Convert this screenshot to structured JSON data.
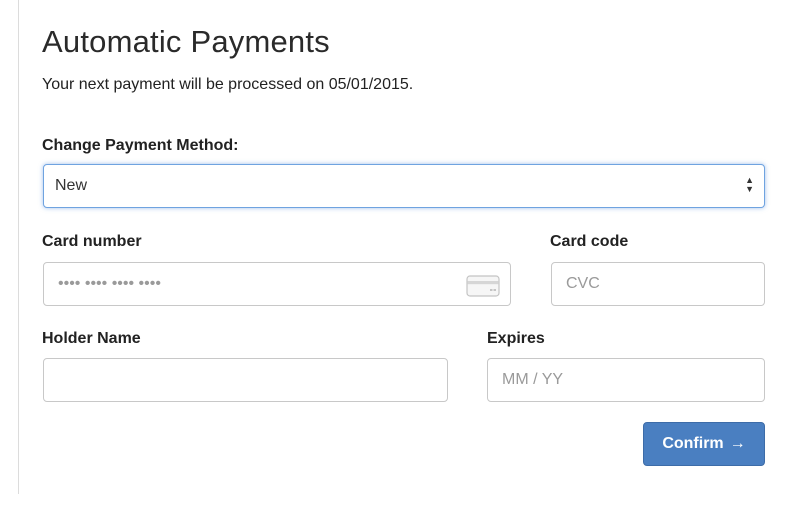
{
  "header": {
    "title": "Automatic Payments",
    "subtitle": "Your next payment will be processed on 05/01/2015."
  },
  "payment_method": {
    "label": "Change Payment Method:",
    "selected": "New"
  },
  "card_number": {
    "label": "Card number",
    "placeholder": "•••• •••• •••• ••••",
    "icon": "credit-card-icon"
  },
  "card_code": {
    "label": "Card code",
    "placeholder": "CVC"
  },
  "holder_name": {
    "label": "Holder Name",
    "value": ""
  },
  "expires": {
    "label": "Expires",
    "placeholder": "MM / YY"
  },
  "actions": {
    "confirm_label": "Confirm",
    "confirm_arrow": "→",
    "confirm_color": "#4a7fc1"
  },
  "colors": {
    "focus_border": "#6fa3e0",
    "text": "#333333"
  }
}
